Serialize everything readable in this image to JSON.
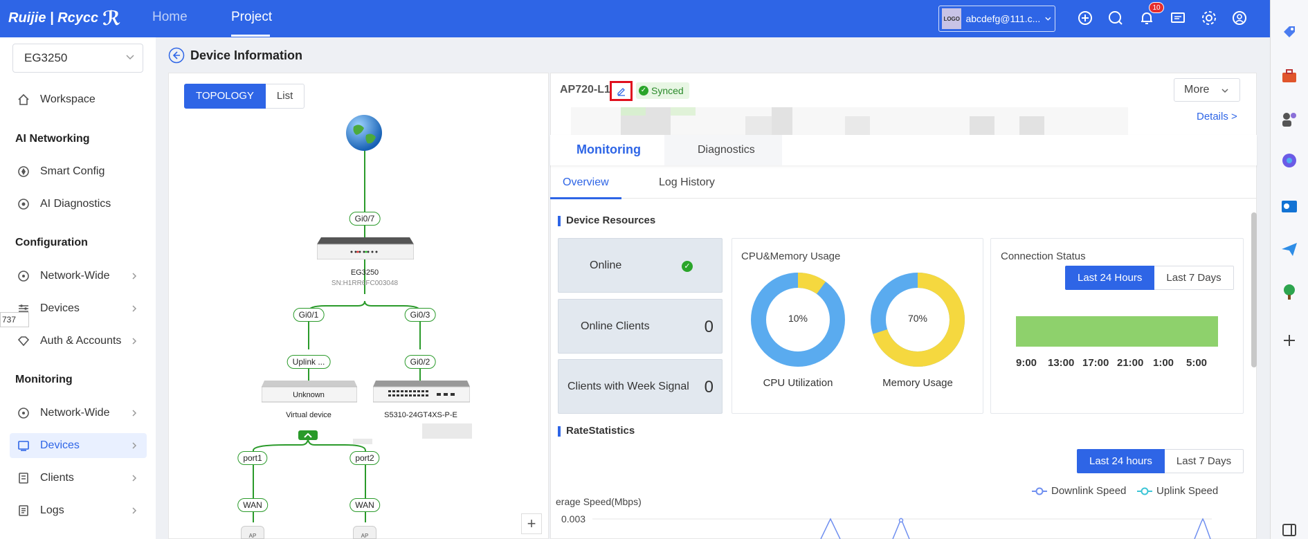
{
  "header": {
    "brand": "Ruijie | Rcycc",
    "nav": [
      {
        "label": "Home"
      },
      {
        "label": "Project"
      }
    ],
    "account_logo": "LOGO",
    "account": "abcdefg@111.c...",
    "notifications": "10"
  },
  "sidebar": {
    "device_select": "EG3250",
    "workspace": "Workspace",
    "ai_heading": "AI Networking",
    "smart_config": "Smart Config",
    "ai_diagnostics": "AI Diagnostics",
    "config_heading": "Configuration",
    "config_network": "Network-Wide",
    "config_devices": "Devices",
    "config_auth": "Auth & Accounts",
    "mon_heading": "Monitoring",
    "mon_network": "Network-Wide",
    "mon_devices": "Devices",
    "mon_clients": "Clients",
    "mon_logs": "Logs",
    "tooltip": "737"
  },
  "page": {
    "title": "Device Information"
  },
  "topology": {
    "view_toggle": [
      "TOPOLOGY",
      "List"
    ],
    "ports": {
      "gi07": "Gi0/7",
      "gi01": "Gi0/1",
      "gi03": "Gi0/3",
      "uplink": "Uplink ...",
      "gi02": "Gi0/2",
      "port1": "port1",
      "port2": "port2",
      "wan1": "WAN",
      "wan2": "WAN"
    },
    "gateway_name": "EG3250",
    "gateway_sn": "SN:H1RR6FC003048",
    "unknown_label": "Unknown",
    "virtual_name": "Virtual device",
    "switch_name": "S5310-24GT4XS-P-E",
    "ap_label": "AP",
    "zoom_in": "+"
  },
  "device": {
    "name": "AP720-L1",
    "sync_status": "Synced",
    "more": "More",
    "details_link": "Details >",
    "tabs": [
      "Monitoring",
      "Diagnostics"
    ],
    "subtabs": [
      "Overview",
      "Log History"
    ]
  },
  "resources": {
    "heading": "Device Resources",
    "online_label": "Online",
    "clients_label": "Online Clients",
    "clients_value": "0",
    "weak_label": "Clients with Week Signal",
    "weak_value": "0",
    "cpu_card_title": "CPU&Memory Usage",
    "cpu_pct": "10%",
    "mem_pct": "70%",
    "cpu_label": "CPU Utilization",
    "mem_label": "Memory Usage",
    "conn_title": "Connection Status",
    "conn_range": [
      "Last 24 Hours",
      "Last 7 Days"
    ],
    "conn_times": [
      "9:00",
      "13:00",
      "17:00",
      "21:00",
      "1:00",
      "5:00"
    ],
    "colors": {
      "cpu": "#5aabef",
      "mem": "#f5d83f",
      "status_bar": "#8ed16c"
    }
  },
  "rate": {
    "heading": "RateStatistics",
    "range": [
      "Last 24 hours",
      "Last 7 Days"
    ],
    "legend_down": "Downlink Speed",
    "legend_up": "Uplink Speed",
    "ylabel": "erage Speed(Mbps)",
    "ytick_top": "0.003"
  }
}
